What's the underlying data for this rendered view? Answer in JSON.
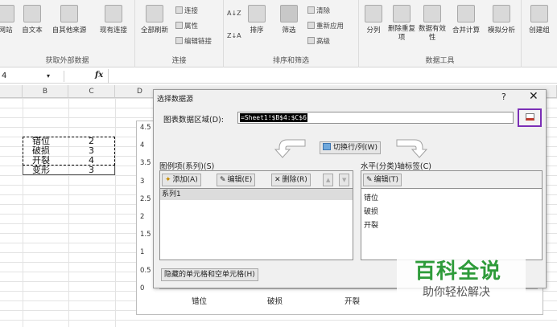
{
  "ribbon": {
    "groups": [
      {
        "title": "获取外部数据",
        "buttons": [
          "网站",
          "自文本",
          "自其他来源",
          "现有连接"
        ]
      },
      {
        "title": "连接",
        "buttons": [
          "全部刷新"
        ],
        "small": [
          "连接",
          "属性",
          "编辑链接"
        ]
      },
      {
        "title": "排序和筛选",
        "buttons": [
          "排序",
          "筛选"
        ],
        "small": [
          "清除",
          "重新应用",
          "高级"
        ],
        "sort_asc": "A↓Z",
        "sort_desc": "Z↓A"
      },
      {
        "title": "数据工具",
        "buttons": [
          "分列",
          "删除重复项",
          "数据有效性",
          "合并计算",
          "模拟分析"
        ]
      },
      {
        "title": "",
        "buttons": [
          "创建组"
        ]
      }
    ]
  },
  "formula_bar": {
    "name_box": "4",
    "fx": "fx",
    "cancel": "▾"
  },
  "columns": [
    "B",
    "C",
    "D"
  ],
  "cells": [
    {
      "b": "错位",
      "c": "2"
    },
    {
      "b": "破损",
      "c": "3"
    },
    {
      "b": "开裂",
      "c": "4"
    },
    {
      "b": "变形",
      "c": "3"
    }
  ],
  "chart": {
    "y_ticks": [
      "4.5",
      "4",
      "3.5",
      "3",
      "2.5",
      "2",
      "1.5",
      "1",
      "0.5",
      "0"
    ],
    "x_labels": [
      "错位",
      "破损",
      "开裂"
    ]
  },
  "dialog": {
    "title": "选择数据源",
    "help": "?",
    "close": "✕",
    "range_label": "图表数据区域(D):",
    "range_value": "=Sheet1!$B$4:$C$6",
    "switch_label": "切换行/列(W)",
    "legend_label": "图例项(系列)(S)",
    "add_label": "添加(A)",
    "edit_label": "编辑(E)",
    "delete_label": "删除(R)",
    "up_label": "▲",
    "down_label": "▼",
    "series": [
      "系列1"
    ],
    "axis_label": "水平(分类)轴标签(C)",
    "axis_edit_label": "编辑(T)",
    "categories": [
      "错位",
      "破损",
      "开裂"
    ],
    "hidden_label": "隐藏的单元格和空单元格(H)"
  },
  "watermark": {
    "title": "百科全说",
    "subtitle": "助你轻松解决"
  },
  "colors": {
    "highlight": "#7b2fb6",
    "selection": "#000000",
    "watermark": "#2e9b3a"
  }
}
